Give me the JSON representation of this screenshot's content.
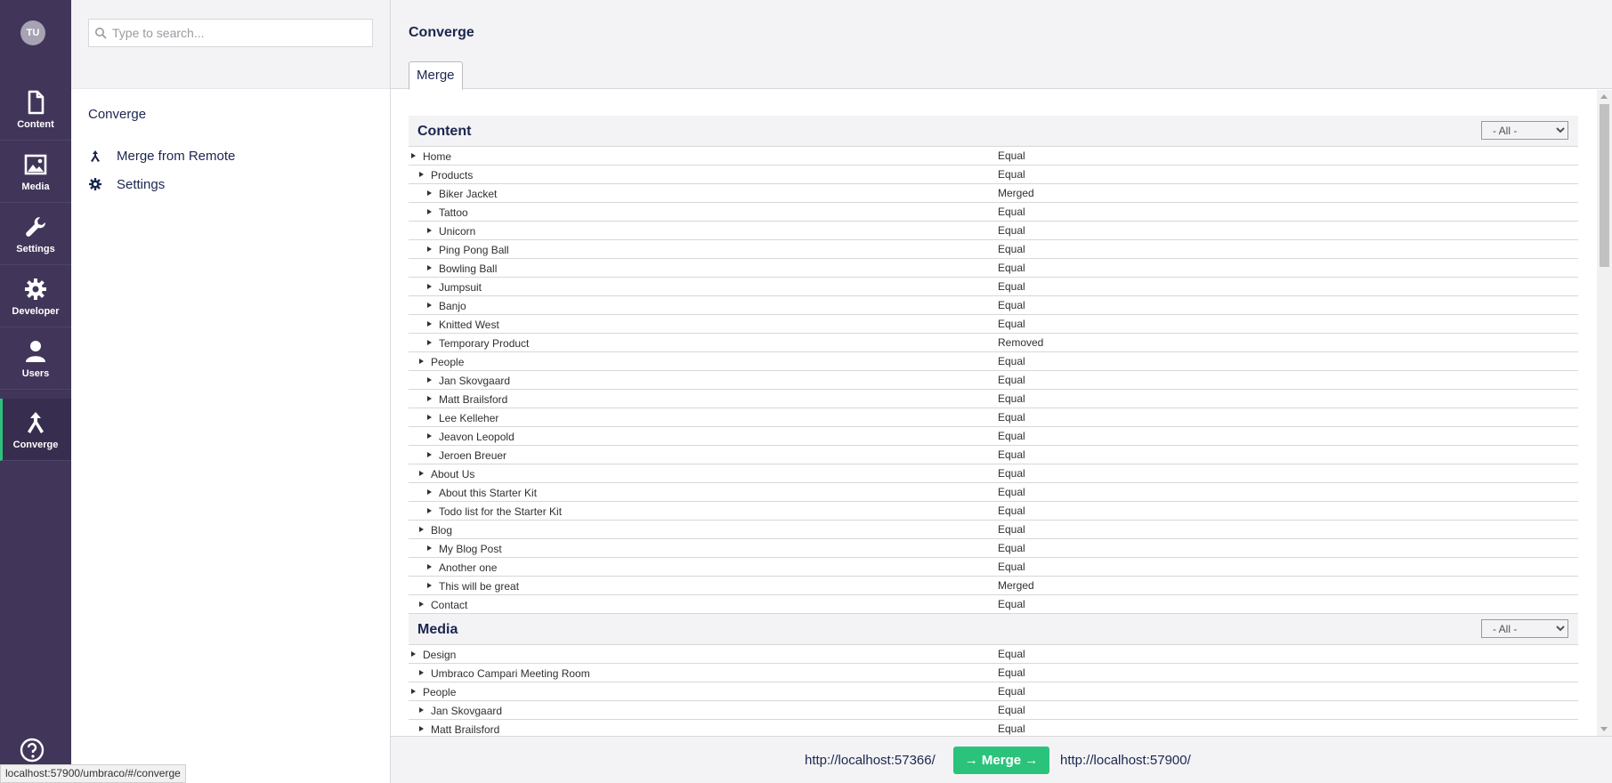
{
  "user": {
    "initials": "TU"
  },
  "sections": [
    {
      "label": "Content",
      "icon": "document-icon"
    },
    {
      "label": "Media",
      "icon": "image-icon"
    },
    {
      "label": "Settings",
      "icon": "wrench-icon"
    },
    {
      "label": "Developer",
      "icon": "gear-icon"
    },
    {
      "label": "Users",
      "icon": "user-icon"
    },
    {
      "label": "Converge",
      "icon": "merge-icon",
      "active": true
    }
  ],
  "tree": {
    "search_placeholder": "Type to search...",
    "title": "Converge",
    "items": [
      {
        "label": "Merge from Remote",
        "icon": "merge-icon"
      },
      {
        "label": "Settings",
        "icon": "gear-icon"
      }
    ]
  },
  "main": {
    "title": "Converge",
    "tab": "Merge",
    "groups": [
      {
        "title": "Content",
        "filter": "- All -",
        "rows": [
          {
            "name": "Home",
            "status": "Equal",
            "level": 0
          },
          {
            "name": "Products",
            "status": "Equal",
            "level": 1
          },
          {
            "name": "Biker Jacket",
            "status": "Merged",
            "level": 2
          },
          {
            "name": "Tattoo",
            "status": "Equal",
            "level": 2
          },
          {
            "name": "Unicorn",
            "status": "Equal",
            "level": 2
          },
          {
            "name": "Ping Pong Ball",
            "status": "Equal",
            "level": 2
          },
          {
            "name": "Bowling Ball",
            "status": "Equal",
            "level": 2
          },
          {
            "name": "Jumpsuit",
            "status": "Equal",
            "level": 2
          },
          {
            "name": "Banjo",
            "status": "Equal",
            "level": 2
          },
          {
            "name": "Knitted West",
            "status": "Equal",
            "level": 2
          },
          {
            "name": "Temporary Product",
            "status": "Removed",
            "level": 2
          },
          {
            "name": "People",
            "status": "Equal",
            "level": 1
          },
          {
            "name": "Jan Skovgaard",
            "status": "Equal",
            "level": 2
          },
          {
            "name": "Matt Brailsford",
            "status": "Equal",
            "level": 2
          },
          {
            "name": "Lee Kelleher",
            "status": "Equal",
            "level": 2
          },
          {
            "name": "Jeavon Leopold",
            "status": "Equal",
            "level": 2
          },
          {
            "name": "Jeroen Breuer",
            "status": "Equal",
            "level": 2
          },
          {
            "name": "About Us",
            "status": "Equal",
            "level": 1
          },
          {
            "name": "About this Starter Kit",
            "status": "Equal",
            "level": 2
          },
          {
            "name": "Todo list for the Starter Kit",
            "status": "Equal",
            "level": 2
          },
          {
            "name": "Blog",
            "status": "Equal",
            "level": 1
          },
          {
            "name": "My Blog Post",
            "status": "Equal",
            "level": 2
          },
          {
            "name": "Another one",
            "status": "Equal",
            "level": 2
          },
          {
            "name": "This will be great",
            "status": "Merged",
            "level": 2
          },
          {
            "name": "Contact",
            "status": "Equal",
            "level": 1
          }
        ]
      },
      {
        "title": "Media",
        "filter": "- All -",
        "rows": [
          {
            "name": "Design",
            "status": "Equal",
            "level": 0
          },
          {
            "name": "Umbraco Campari Meeting Room",
            "status": "Equal",
            "level": 1
          },
          {
            "name": "People",
            "status": "Equal",
            "level": 0
          },
          {
            "name": "Jan Skovgaard",
            "status": "Equal",
            "level": 1
          },
          {
            "name": "Matt Brailsford",
            "status": "Equal",
            "level": 1
          }
        ]
      }
    ]
  },
  "footer": {
    "source_url": "http://localhost:57366/",
    "merge_label": "→ Merge →",
    "target_url": "http://localhost:57900/"
  },
  "statusbar": {
    "text": "localhost:57900/umbraco/#/converge"
  },
  "colors": {
    "nav_bg": "#413659",
    "accent": "#2bc37c",
    "panel_bg": "#f3f3f5"
  }
}
